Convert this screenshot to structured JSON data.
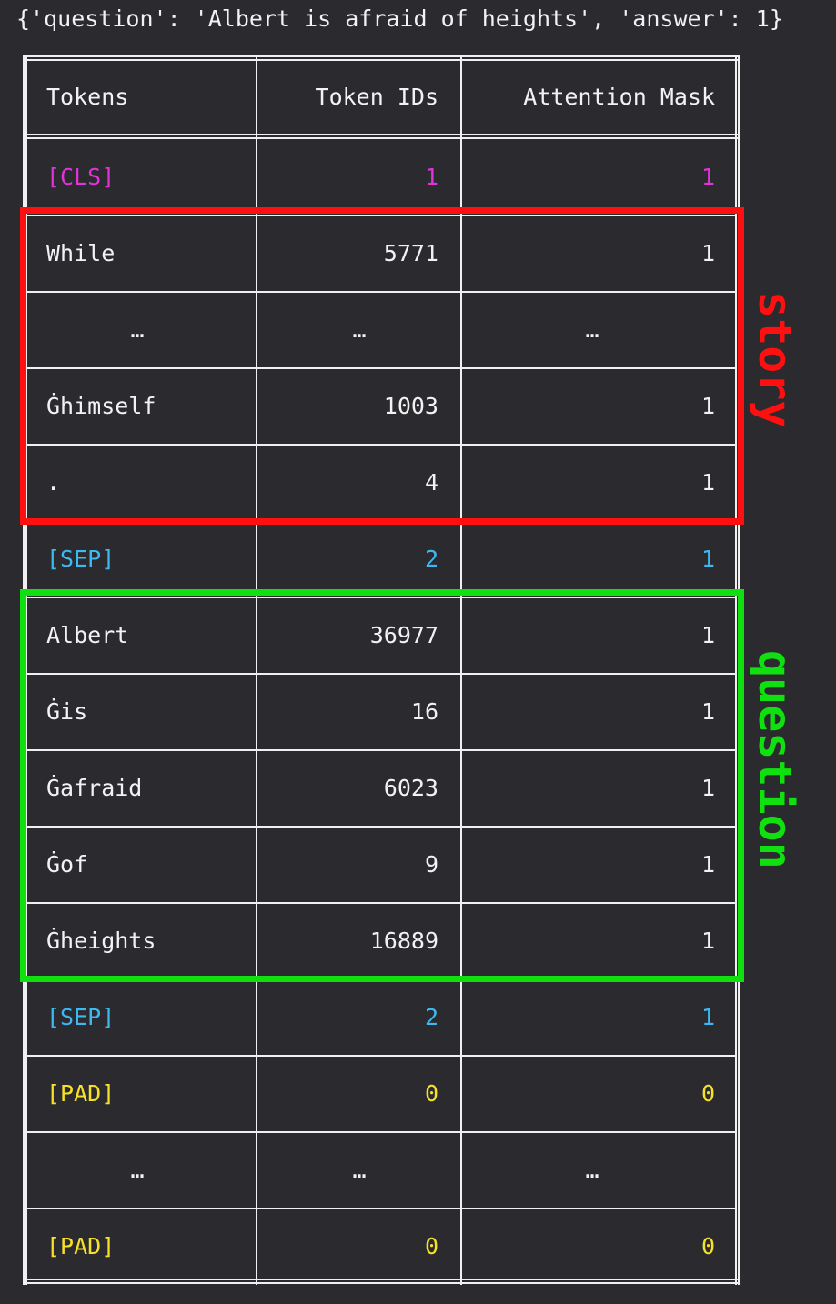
{
  "header": "{'question': 'Albert is afraid of heights', 'answer': 1}",
  "columns": [
    "Tokens",
    "Token IDs",
    "Attention Mask"
  ],
  "rows": [
    {
      "token": "[CLS]",
      "id": "1",
      "mask": "1",
      "color": "#e033d8"
    },
    {
      "token": "While",
      "id": "5771",
      "mask": "1",
      "color": "#f2f2f2"
    },
    {
      "token": "…",
      "id": "…",
      "mask": "…",
      "color": "#f2f2f2",
      "ellipsis": true
    },
    {
      "token": "Ġhimself",
      "id": "1003",
      "mask": "1",
      "color": "#f2f2f2"
    },
    {
      "token": ".",
      "id": "4",
      "mask": "1",
      "color": "#f2f2f2"
    },
    {
      "token": "[SEP]",
      "id": "2",
      "mask": "1",
      "color": "#3db9f2"
    },
    {
      "token": "Albert",
      "id": "36977",
      "mask": "1",
      "color": "#f2f2f2"
    },
    {
      "token": "Ġis",
      "id": "16",
      "mask": "1",
      "color": "#f2f2f2"
    },
    {
      "token": "Ġafraid",
      "id": "6023",
      "mask": "1",
      "color": "#f2f2f2"
    },
    {
      "token": "Ġof",
      "id": "9",
      "mask": "1",
      "color": "#f2f2f2"
    },
    {
      "token": "Ġheights",
      "id": "16889",
      "mask": "1",
      "color": "#f2f2f2"
    },
    {
      "token": "[SEP]",
      "id": "2",
      "mask": "1",
      "color": "#3db9f2"
    },
    {
      "token": "[PAD]",
      "id": "0",
      "mask": "0",
      "color": "#f5e02a"
    },
    {
      "token": "…",
      "id": "…",
      "mask": "…",
      "color": "#f2f2f2",
      "ellipsis": true
    },
    {
      "token": "[PAD]",
      "id": "0",
      "mask": "0",
      "color": "#f5e02a"
    }
  ],
  "annotations": {
    "story": {
      "label": "story",
      "color": "#ff1010"
    },
    "question": {
      "label": "question",
      "color": "#10e010"
    }
  }
}
